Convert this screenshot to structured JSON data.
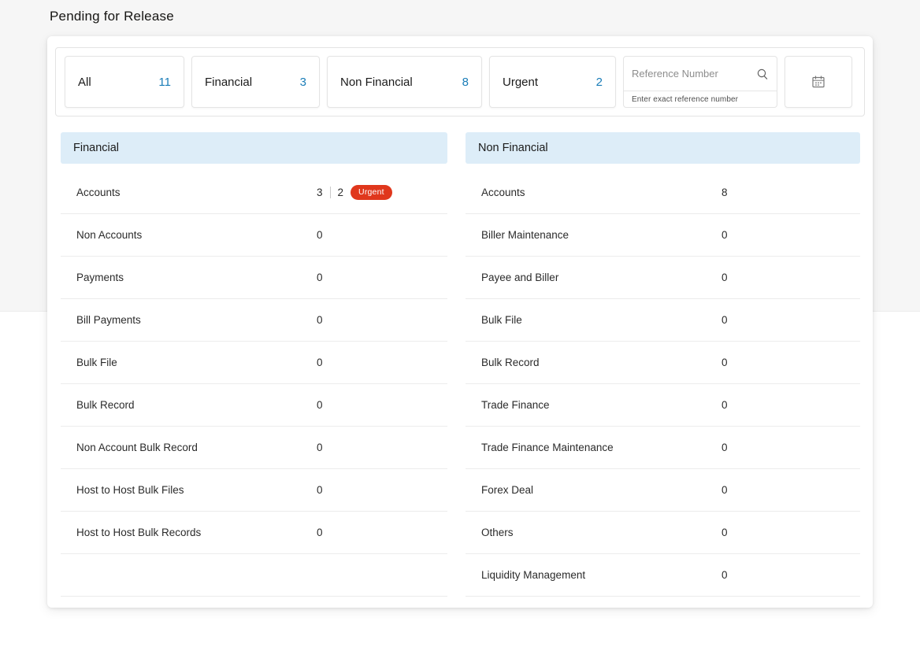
{
  "page": {
    "title": "Pending for Release"
  },
  "filters": {
    "tabs": [
      {
        "label": "All",
        "count": 11
      },
      {
        "label": "Financial",
        "count": 3
      },
      {
        "label": "Non Financial",
        "count": 8
      },
      {
        "label": "Urgent",
        "count": 2
      }
    ],
    "search": {
      "placeholder": "Reference Number",
      "helper": "Enter exact reference number",
      "icon": "search-icon"
    },
    "date_filter": {
      "icon": "calendar-icon"
    }
  },
  "panels": [
    {
      "title": "Financial",
      "rows": [
        {
          "label": "Accounts",
          "count": 3,
          "urgent": {
            "count": 2,
            "label": "Urgent"
          }
        },
        {
          "label": "Non Accounts",
          "count": 0
        },
        {
          "label": "Payments",
          "count": 0
        },
        {
          "label": "Bill Payments",
          "count": 0
        },
        {
          "label": "Bulk File",
          "count": 0
        },
        {
          "label": "Bulk Record",
          "count": 0
        },
        {
          "label": "Non Account Bulk Record",
          "count": 0
        },
        {
          "label": "Host to Host Bulk Files",
          "count": 0
        },
        {
          "label": "Host to Host Bulk Records",
          "count": 0
        }
      ]
    },
    {
      "title": "Non Financial",
      "rows": [
        {
          "label": "Accounts",
          "count": 8
        },
        {
          "label": "Biller Maintenance",
          "count": 0
        },
        {
          "label": "Payee and Biller",
          "count": 0
        },
        {
          "label": "Bulk File",
          "count": 0
        },
        {
          "label": "Bulk Record",
          "count": 0
        },
        {
          "label": "Trade Finance",
          "count": 0
        },
        {
          "label": "Trade Finance Maintenance",
          "count": 0
        },
        {
          "label": "Forex Deal",
          "count": 0
        },
        {
          "label": "Others",
          "count": 0
        },
        {
          "label": "Liquidity Management",
          "count": 0
        }
      ]
    }
  ],
  "colors": {
    "accent": "#1a7db8",
    "urgent_badge": "#e0371c",
    "panel_header_bg": "#ddedf8"
  }
}
